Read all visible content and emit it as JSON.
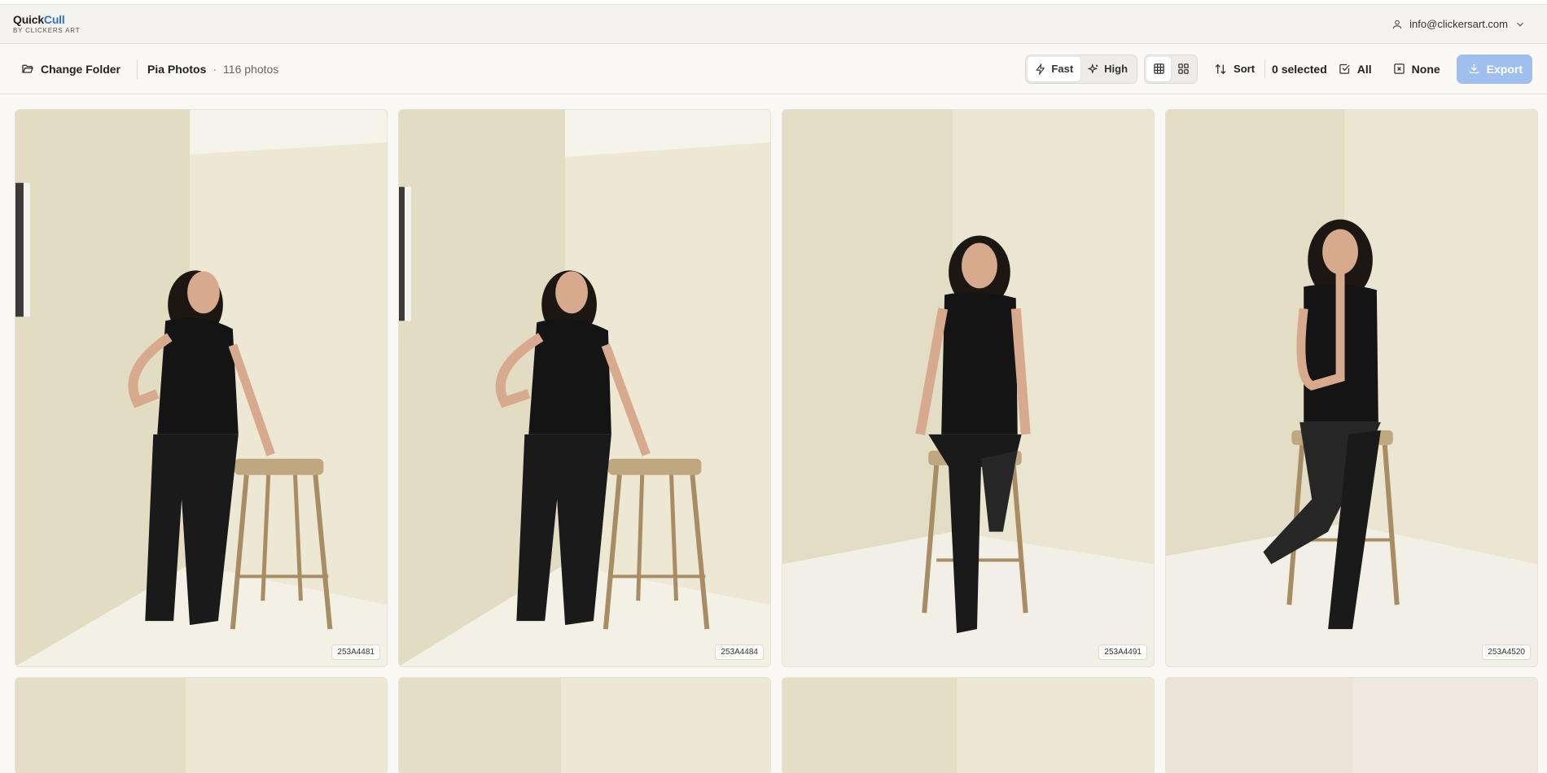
{
  "app": {
    "brand_part1": "Quick",
    "brand_part2": "Cull",
    "brand_sub": "BY CLICKERS ART",
    "account_email": "info@clickersart.com"
  },
  "toolbar": {
    "change_folder": "Change Folder",
    "folder_name": "Pia Photos",
    "separator": "·",
    "photo_count": "116 photos",
    "quality_fast": "Fast",
    "quality_high": "High",
    "sort": "Sort",
    "selected": "0 selected",
    "select_all": "All",
    "select_none": "None",
    "export": "Export"
  },
  "photos": [
    {
      "filename": "253A4481"
    },
    {
      "filename": "253A4484"
    },
    {
      "filename": "253A4491"
    },
    {
      "filename": "253A4520"
    }
  ],
  "colors": {
    "brand_accent": "#2f6fd6",
    "export_button": "#9fc0ee",
    "photo_wall": "#ebe6d4"
  }
}
